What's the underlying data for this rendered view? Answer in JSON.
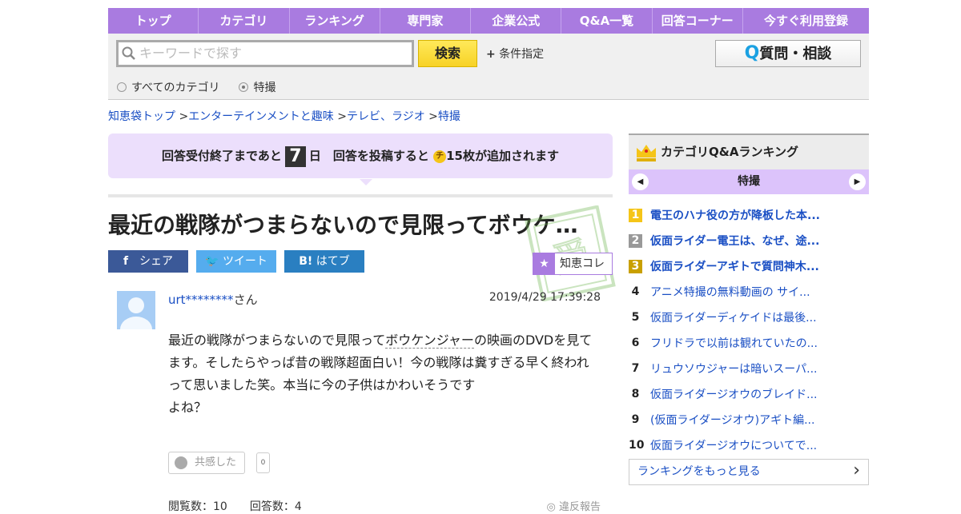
{
  "nav": [
    "トップ",
    "カテゴリ",
    "ランキング",
    "専門家",
    "企業公式",
    "Q&A一覧",
    "回答コーナー",
    "今すぐ利用登録"
  ],
  "search": {
    "placeholder": "キーワードで探す",
    "button": "検索",
    "conditions": "条件指定",
    "ask_q": "Q",
    "ask": "質問・相談",
    "radio_all": "すべてのカテゴリ",
    "radio_cat": "特撮"
  },
  "breadcrumb": [
    "知恵袋トップ",
    "エンターテインメントと趣味",
    "テレビ、ラジオ",
    "特撮"
  ],
  "notice": {
    "pre": "回答受付終了まであと",
    "days": "7",
    "day_unit": "日",
    "post": "回答を投稿すると",
    "coin": "チ",
    "bonus": "15枚が追加されます"
  },
  "question": {
    "title": "最近の戦隊がつまらないので見限ってボウケ…",
    "stamp": "受付中",
    "user": "urt********",
    "san": "さん",
    "date": "2019/4/29  17:39:28",
    "body_pre": "最近の戦隊がつまらないので見限って",
    "body_link": "ボウケンジャー",
    "body_post": "の映画のDVDを見てます。そしたらやっぱ昔の戦隊超面白い！今の戦隊は糞すぎる早く終われって思いました笑。本当に今の子供はかわいそうです",
    "body_end": "よね？",
    "empathy": "共感した",
    "empathy_count": "0",
    "stats": "閲覧数：10　　回答数：4",
    "report": "違反報告"
  },
  "share": {
    "fb": "シェア",
    "tw": "ツイート",
    "hb": "はてブ",
    "chie": "知恵コレ"
  },
  "ranking": {
    "title": "カテゴリQ&Aランキング",
    "category": "特撮",
    "more": "ランキングをもっと見る",
    "colors": [
      "#f5c518",
      "#999999",
      "#c9a000"
    ],
    "items": [
      {
        "n": "1",
        "t": "電王のハナ役の方が降板した本..."
      },
      {
        "n": "2",
        "t": "仮面ライダー電王は、なぜ、途..."
      },
      {
        "n": "3",
        "t": "仮面ライダーアギトで質問神木..."
      },
      {
        "n": "4",
        "t": "アニメ特撮の無料動画の サイ..."
      },
      {
        "n": "5",
        "t": "仮面ライダーディケイドは最後..."
      },
      {
        "n": "6",
        "t": "フリドラで以前は観れていたの..."
      },
      {
        "n": "7",
        "t": "リュウソウジャーは暗いスーパ..."
      },
      {
        "n": "8",
        "t": "仮面ライダージオウのブレイド..."
      },
      {
        "n": "9",
        "t": "(仮面ライダージオウ)アギト編..."
      },
      {
        "n": "10",
        "t": "仮面ライダージオウについてで..."
      }
    ]
  }
}
